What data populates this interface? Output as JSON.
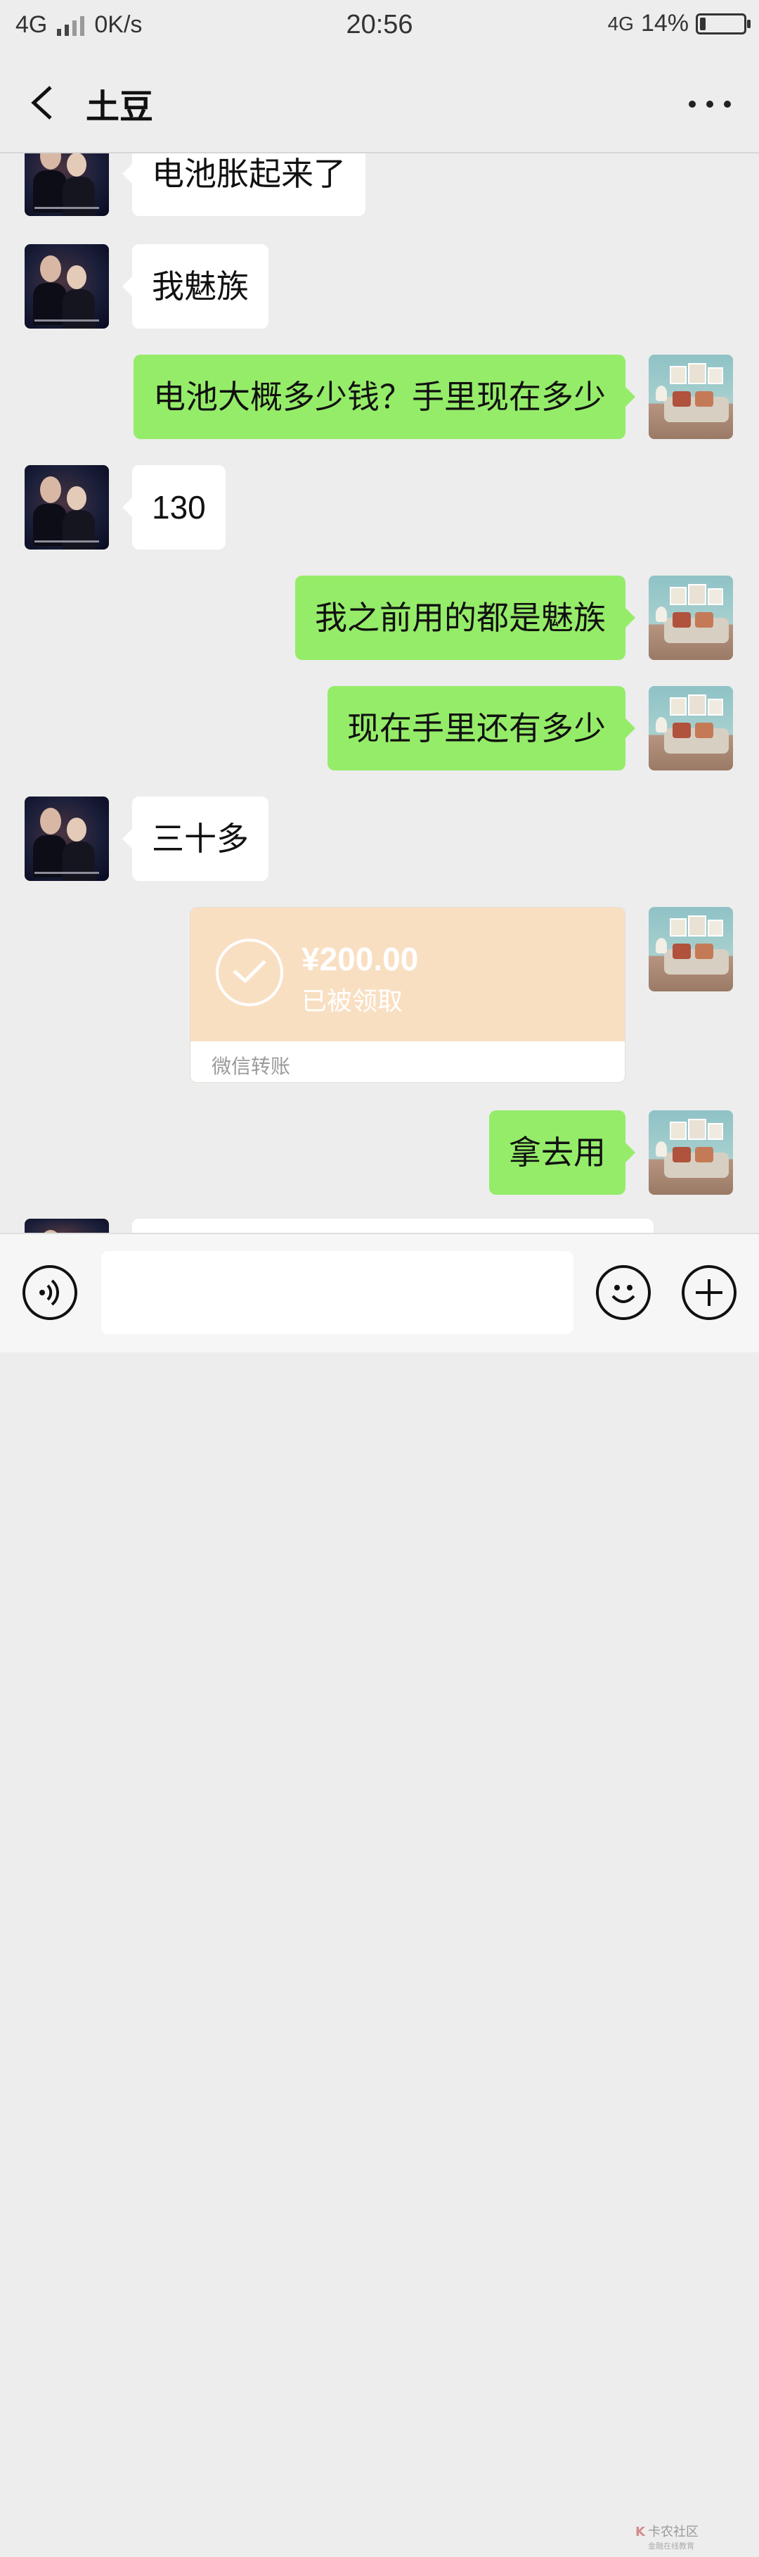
{
  "status_bar": {
    "network": "4G",
    "speed": "0K/s",
    "time": "20:56",
    "network_right": "4G",
    "battery": "14%",
    "battery_level": 0.14
  },
  "nav": {
    "title": "土豆"
  },
  "messages": [
    {
      "from": "them",
      "text": "电池胀起来了"
    },
    {
      "from": "them",
      "text": "我魅族"
    },
    {
      "from": "me",
      "text": "电池大概多少钱？手里现在多少"
    },
    {
      "from": "them",
      "text": "130"
    },
    {
      "from": "me",
      "text": "我之前用的都是魅族"
    },
    {
      "from": "me",
      "text": "现在手里还有多少"
    },
    {
      "from": "them",
      "text": "三十多"
    },
    {
      "from": "me",
      "type": "transfer",
      "amount": "¥200.00",
      "status": "已被领取",
      "footer": "微信转账"
    },
    {
      "from": "me",
      "text": "拿去用"
    }
  ],
  "input": {
    "placeholder": ""
  },
  "watermark": {
    "text": "卡农社区",
    "sub": "金融在线教育"
  },
  "colors": {
    "background": "#ededed",
    "my_bubble": "#95ec69",
    "their_bubble": "#ffffff",
    "transfer": "#f9dfc2"
  }
}
